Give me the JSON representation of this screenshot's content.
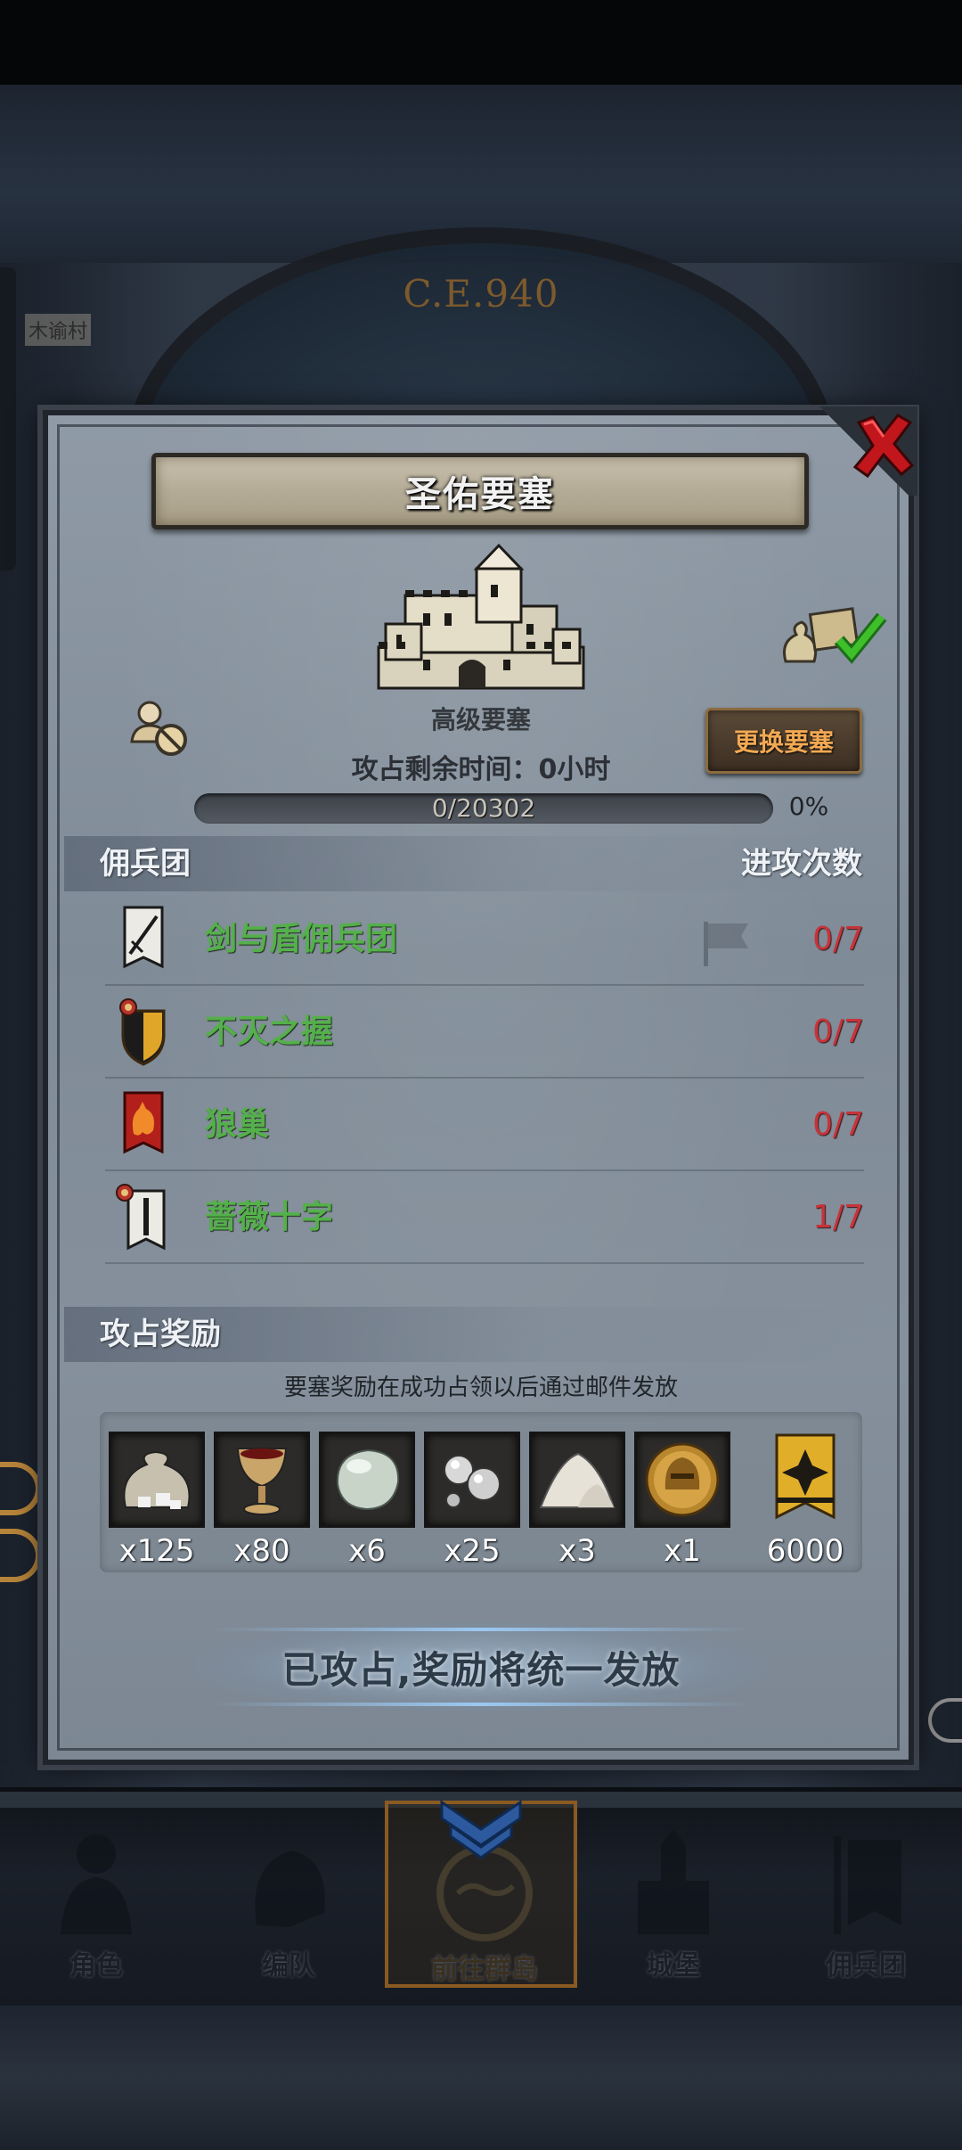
{
  "map": {
    "era_label": "C.E.940",
    "village_label": "木谕村"
  },
  "dialog": {
    "title": "圣佑要塞",
    "fortress_level": "高级要塞",
    "change_button": "更换要塞",
    "remaining_time": "攻占剩余时间：0小时",
    "progress": {
      "text": "0/20302",
      "percent": "0%",
      "fraction": 0
    },
    "mercenary_section": {
      "label": "佣兵团",
      "attack_count_label": "进攻次数"
    },
    "mercenaries": [
      {
        "name": "剑与盾佣兵团",
        "count": "0/7",
        "emblem": "sword-banner-icon"
      },
      {
        "name": "不灭之握",
        "count": "0/7",
        "emblem": "shield-emblem-icon"
      },
      {
        "name": "狼巢",
        "count": "0/7",
        "emblem": "wolf-banner-icon"
      },
      {
        "name": "蔷薇十字",
        "count": "1/7",
        "emblem": "rose-cross-banner-icon"
      }
    ],
    "reward_section": {
      "label": "攻占奖励"
    },
    "reward_note": "要塞奖励在成功占领以后通过邮件发放",
    "rewards": [
      {
        "icon": "silver-ore-sack-icon",
        "qty": "x125"
      },
      {
        "icon": "goblet-icon",
        "qty": "x80"
      },
      {
        "icon": "moonstone-icon",
        "qty": "x6"
      },
      {
        "icon": "silver-pearls-icon",
        "qty": "x25"
      },
      {
        "icon": "salt-pile-icon",
        "qty": "x3"
      },
      {
        "icon": "golden-helmet-coin-icon",
        "qty": "x1"
      },
      {
        "icon": "guild-banner-icon",
        "qty": "6000"
      }
    ],
    "status_text": "已攻占,奖励将统一发放"
  },
  "nav": {
    "items": [
      {
        "label": "角色",
        "icon": "knight-icon"
      },
      {
        "label": "编队",
        "icon": "helmet-icon"
      },
      {
        "label": "前往群岛",
        "icon": "islands-compass-icon"
      },
      {
        "label": "城堡",
        "icon": "castle-icon"
      },
      {
        "label": "佣兵团",
        "icon": "mercenary-icon"
      }
    ],
    "active_index": 2
  },
  "colors": {
    "merc_name": "#54b04a",
    "attack_count": "#c6343a",
    "change_button_text": "#f3a953",
    "reward_qty": "#ffffff"
  }
}
